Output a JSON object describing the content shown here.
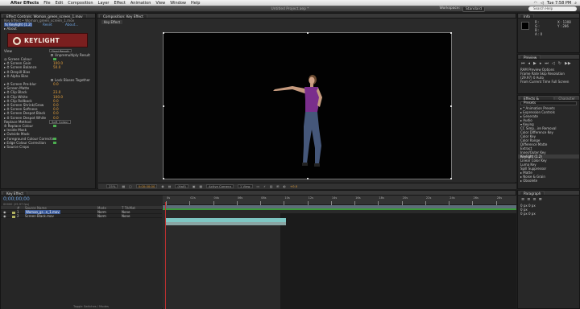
{
  "menubar": {
    "app": "After Effects",
    "items": [
      "File",
      "Edit",
      "Composition",
      "Layer",
      "Effect",
      "Animation",
      "View",
      "Window",
      "Help"
    ],
    "clock": "Tue 7:58 PM"
  },
  "titlebar": {
    "title": "Untitled Project.aep *",
    "workspace_label": "Workspace:",
    "workspace_value": "Standard",
    "search_placeholder": "Search Help"
  },
  "effect_controls": {
    "tab": "Effect Controls: Woman_green_screen_1.mov",
    "breadcrumb": "Key Effect • Woman_green_screen_1.mov",
    "rows": [
      {
        "label": "fx  Keylight (1.2)",
        "value": "Reset",
        "value2": "About..."
      },
      {
        "label": "▸ About"
      }
    ],
    "logo_text": "KEYLIGHT",
    "logo_sub": "",
    "params": [
      {
        "label": "View",
        "value": "Final Result"
      },
      {
        "label": "",
        "value": "Unpremultiply Result",
        "checkbox": true
      },
      {
        "label": "◎ Screen Colour",
        "value": ""
      },
      {
        "label": "▸ ⏱ Screen Gain",
        "value": "100.0"
      },
      {
        "label": "▸ ⏱ Screen Balance",
        "value": "50.0"
      },
      {
        "label": "▸ ⏱ Despill Bias",
        "value": ""
      },
      {
        "label": "▸ ⏱ Alpha Bias",
        "value": ""
      },
      {
        "label": "",
        "value": "Lock Biases Together",
        "checkbox": true
      },
      {
        "label": "▸ ⏱ Screen Pre-blur",
        "value": "0.0"
      },
      {
        "label": "▾ Screen Matte",
        "value": ""
      },
      {
        "label": "   ▸ ⏱ Clip Black",
        "value": "23.0"
      },
      {
        "label": "   ▸ ⏱ Clip White",
        "value": "100.0"
      },
      {
        "label": "   ▸ ⏱ Clip Rollback",
        "value": "0.0"
      },
      {
        "label": "   ▸ ⏱ Screen Shrink/Grow",
        "value": "0.0"
      },
      {
        "label": "   ▸ ⏱ Screen Softness",
        "value": "0.0"
      },
      {
        "label": "   ▸ ⏱ Screen Despot Black",
        "value": "0.0"
      },
      {
        "label": "   ▸ ⏱ Screen Despot White",
        "value": "0.0"
      },
      {
        "label": "      Replace Method",
        "value": "Soft Colour"
      },
      {
        "label": "      ⏱ Replace Colour",
        "value": ""
      },
      {
        "label": "▸ Inside Mask",
        "value": ""
      },
      {
        "label": "▸ Outside Mask",
        "value": ""
      },
      {
        "label": "▸ Foreground Colour Correction",
        "value": ""
      },
      {
        "label": "▸ Edge Colour Correction",
        "value": ""
      },
      {
        "label": "▸ Source Crops",
        "value": ""
      }
    ]
  },
  "composition": {
    "tab": "Composition: Key Effect",
    "viewer_tab": "Key Effect",
    "viewer_bar": [
      "25%",
      "0:00:00:00",
      "(Half)",
      "Active Camera",
      "1 View",
      "+0.0"
    ]
  },
  "info_panel": {
    "tab": "Info",
    "rows": [
      "R :",
      "G :",
      "B :",
      "A : 0",
      "X : 1308",
      "Y : 286"
    ]
  },
  "preview_panel": {
    "tab": "Preview",
    "rows": [
      "RAM Preview Options",
      "Frame Rate  Skip  Resolution",
      "(29.97)   0   Auto",
      "From Current Time   Full Screen"
    ]
  },
  "effects_presets": {
    "tab": "Effects & Presets",
    "tab2": "Character",
    "items": [
      {
        "label": "▸ * Animation Presets"
      },
      {
        "label": "▸ Expression Controls"
      },
      {
        "label": "▸ Generate"
      },
      {
        "label": "▸ Audio"
      },
      {
        "label": "▾ Keying"
      },
      {
        "label": "   CC Simp...ire Removal"
      },
      {
        "label": "   Color Difference Key"
      },
      {
        "label": "   Color Key"
      },
      {
        "label": "   Color Range"
      },
      {
        "label": "   Difference Matte"
      },
      {
        "label": "   Extract"
      },
      {
        "label": "   Inner/Outer Key"
      },
      {
        "label": "   Keylight (1.2)",
        "highlight": true
      },
      {
        "label": "   Linear Color Key"
      },
      {
        "label": "   Luma Key"
      },
      {
        "label": "   Spill Suppressor"
      },
      {
        "label": "▸ Matte"
      },
      {
        "label": "▸ Noise & Grain"
      },
      {
        "label": "▸ Obsolete"
      }
    ]
  },
  "timeline": {
    "tab": "Key Effect",
    "timecode": "0;00;00;00",
    "fps": "00000 (29.97 fps)",
    "columns": [
      "#",
      "Source Name",
      "Mode",
      "T  TrkMat"
    ],
    "layers": [
      {
        "num": "1",
        "name": "Woman_gr...n_1.mov",
        "mode": "Norm",
        "trk": "None"
      },
      {
        "num": "2",
        "name": "Screen Black.mov",
        "mode": "Norm",
        "trk": "None"
      }
    ],
    "ruler_labels": [
      "0s",
      "02s",
      "04s",
      "06s",
      "08s",
      "10s",
      "12s",
      "14s",
      "16s",
      "18s",
      "20s",
      "22s",
      "24s",
      "26s",
      "28s"
    ],
    "bottom": "Toggle Switches / Modes"
  },
  "paragraph": {
    "tab": "Paragraph",
    "rows": [
      "0 px   0 px",
      "0 px",
      "0 px   0 px"
    ]
  }
}
